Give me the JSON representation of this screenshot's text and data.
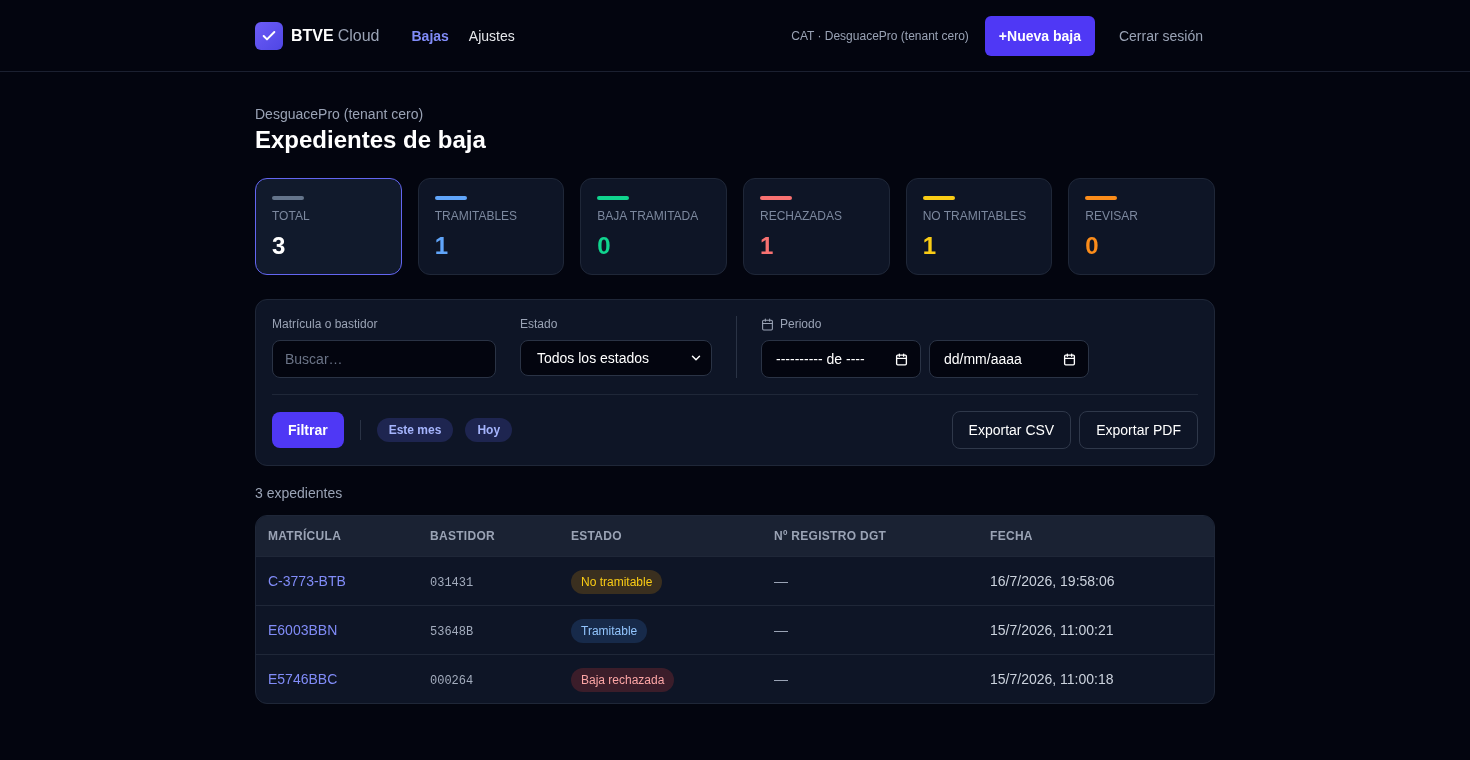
{
  "header": {
    "brand": {
      "name": "BTVE",
      "suffix": "Cloud"
    },
    "nav": [
      {
        "label": "Bajas",
        "selected": true
      },
      {
        "label": "Ajustes",
        "selected": false
      }
    ],
    "tenant": "CAT · DesguacePro (tenant cero)",
    "new_button": "+Nueva baja",
    "logout": "Cerrar sesión"
  },
  "page": {
    "subtitle": "DesguacePro (tenant cero)",
    "title": "Expedientes de baja"
  },
  "stats": [
    {
      "label": "TOTAL",
      "value": {
        "text": "3",
        "color": "#ffffff"
      },
      "color": "#64748b",
      "selected": true
    },
    {
      "label": "TRAMITABLES",
      "value": {
        "text": "1",
        "color": "#60a5fa"
      },
      "color": "#60a5fa",
      "selected": false
    },
    {
      "label": "BAJA TRAMITADA",
      "value": {
        "text": "0",
        "color": "#10d48e"
      },
      "color": "#10d48e",
      "selected": false
    },
    {
      "label": "RECHAZADAS",
      "value": {
        "text": "1",
        "color": "#f87171"
      },
      "color": "#f87171",
      "selected": false
    },
    {
      "label": "NO TRAMITABLES",
      "value": {
        "text": "1",
        "color": "#facc15"
      },
      "color": "#facc15",
      "selected": false
    },
    {
      "label": "REVISAR",
      "value": {
        "text": "0",
        "color": "#fb8c1a"
      },
      "color": "#fb8c1a",
      "selected": false
    }
  ],
  "filters": {
    "search": {
      "label": "Matrícula o bastidor",
      "placeholder": "Buscar…"
    },
    "status": {
      "label": "Estado",
      "value": "Todos los estados"
    },
    "period": {
      "label": "Periodo",
      "from": "---------- de ----",
      "to": "dd/mm/aaaa"
    },
    "filter_button": "Filtrar",
    "quick_ranges": [
      "Este mes",
      "Hoy"
    ],
    "exports": [
      "Exportar CSV",
      "Exportar PDF"
    ]
  },
  "results_count": "3 expedientes",
  "table": {
    "columns": [
      "MATRÍCULA",
      "BASTIDOR",
      "ESTADO",
      "Nº REGISTRO DGT",
      "FECHA"
    ],
    "rows": [
      {
        "plate": "C-3773-BTB",
        "vin": "031431",
        "status": {
          "label": "No tramitable",
          "kind": "warning"
        },
        "dgt_number": "—",
        "date": "16/7/2026, 19:58:06"
      },
      {
        "plate": "E6003BBN",
        "vin": "53648B",
        "status": {
          "label": "Tramitable",
          "kind": "info"
        },
        "dgt_number": "—",
        "date": "15/7/2026, 11:00:21"
      },
      {
        "plate": "E5746BBC",
        "vin": "000264",
        "status": {
          "label": "Baja rechazada",
          "kind": "danger"
        },
        "dgt_number": "—",
        "date": "15/7/2026, 11:00:18"
      }
    ]
  }
}
